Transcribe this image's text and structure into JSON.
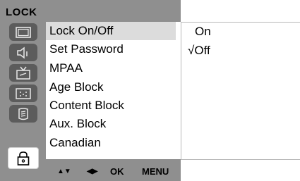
{
  "osd": {
    "title": "LOCK",
    "icons": [
      {
        "name": "picture-icon",
        "active": false
      },
      {
        "name": "audio-icon",
        "active": false
      },
      {
        "name": "tv-antenna-icon",
        "active": false
      },
      {
        "name": "screen-dots-icon",
        "active": false
      },
      {
        "name": "option-book-icon",
        "active": false
      },
      {
        "name": "lock-icon",
        "active": true
      }
    ],
    "menu_items": [
      {
        "label": "Lock On/Off",
        "selected": true
      },
      {
        "label": "Set Password",
        "selected": false
      },
      {
        "label": "MPAA",
        "selected": false
      },
      {
        "label": "Age Block",
        "selected": false
      },
      {
        "label": "Content Block",
        "selected": false
      },
      {
        "label": "Aux. Block",
        "selected": false
      },
      {
        "label": "Canadian",
        "selected": false
      }
    ],
    "nav": {
      "up_down": "▲▼",
      "left_right": "◀▶",
      "ok": "OK",
      "menu": "MENU"
    }
  },
  "submenu": {
    "options": [
      {
        "label": "On",
        "check": ""
      },
      {
        "label": "Off",
        "check": "√"
      }
    ]
  }
}
